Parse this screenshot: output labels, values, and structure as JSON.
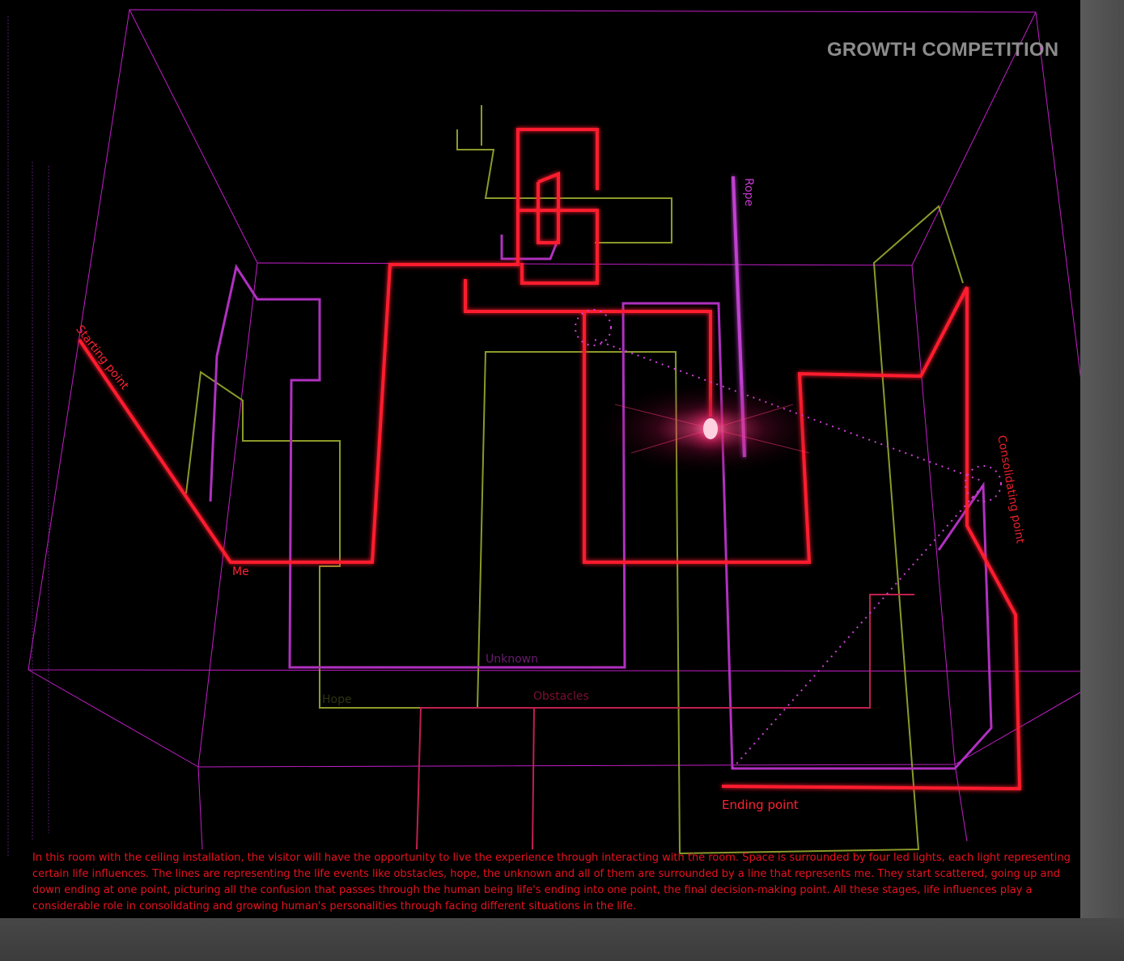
{
  "title": "GROWTH COMPETITION",
  "labels": {
    "starting_point": "Starting point",
    "me": "Me",
    "rope": "Rope",
    "consolidating_point": "Consolidating point",
    "ending_point": "Ending point",
    "unknown": "Unknown",
    "obstacles": "Obstacles",
    "hope": "Hope"
  },
  "description": "In this room with the ceiling installation, the visitor will have the opportunity to live the experience through interacting with the room. Space is surrounded by four led lights, each light representing certain life influences. The lines are representing the life events like obstacles, hope, the unknown and all of them are surrounded by a line that represents me. They start scattered, going up and down ending at one point, picturing all the confusion that passes through the human being life's ending into one point, the final decision-making point. All these stages, life influences play a considerable role in consolidating and growing human's personalities through facing different situations in the life.",
  "colors": {
    "background": "#000000",
    "room_lines": "#c21ec8",
    "me_line": "#ff1c2e",
    "unknown_line": "#b030c0",
    "hope_line": "#8c9a2a",
    "obstacles_line": "#c02050",
    "title": "#8c8c8c",
    "frame": "#454545"
  }
}
